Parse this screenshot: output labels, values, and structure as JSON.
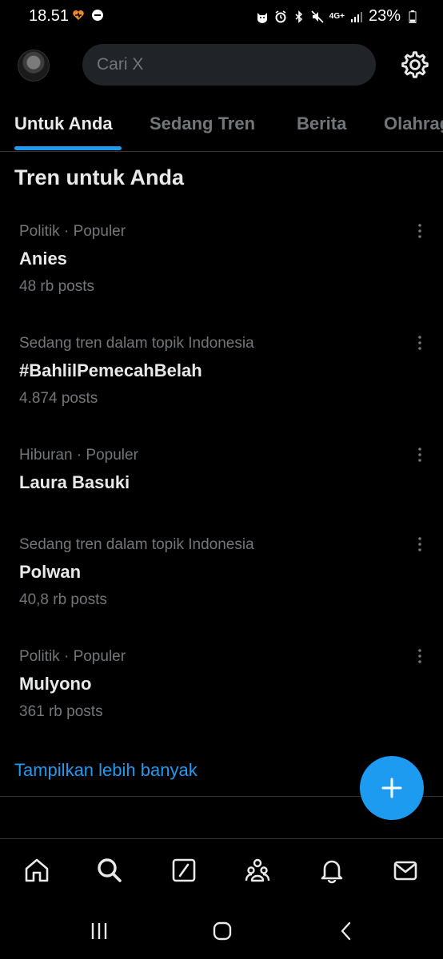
{
  "status_bar": {
    "time": "18.51",
    "network": "4G+",
    "battery": "23%"
  },
  "header": {
    "search_placeholder": "Cari X"
  },
  "tabs": [
    {
      "label": "Untuk Anda",
      "active": true
    },
    {
      "label": "Sedang Tren",
      "active": false
    },
    {
      "label": "Berita",
      "active": false
    },
    {
      "label": "Olahraga",
      "active": false
    }
  ],
  "section_title": "Tren untuk Anda",
  "trends": [
    {
      "meta": "Politik · Populer",
      "name": "Anies",
      "count": "48 rb posts"
    },
    {
      "meta": "Sedang tren dalam topik Indonesia",
      "name": "#BahlilPemecahBelah",
      "count": "4.874 posts"
    },
    {
      "meta": "Hiburan · Populer",
      "name": "Laura Basuki",
      "count": ""
    },
    {
      "meta": "Sedang tren dalam topik Indonesia",
      "name": "Polwan",
      "count": "40,8 rb posts"
    },
    {
      "meta": "Politik · Populer",
      "name": "Mulyono",
      "count": "361 rb posts"
    }
  ],
  "show_more": "Tampilkan lebih banyak",
  "colors": {
    "accent": "#1d9bf0",
    "background": "#000000",
    "muted_text": "#71767b",
    "primary_text": "#e7e9ea"
  },
  "bottom_nav": [
    {
      "icon": "home-icon"
    },
    {
      "icon": "search-icon"
    },
    {
      "icon": "grok-icon"
    },
    {
      "icon": "communities-icon"
    },
    {
      "icon": "notifications-icon"
    },
    {
      "icon": "messages-icon"
    }
  ]
}
